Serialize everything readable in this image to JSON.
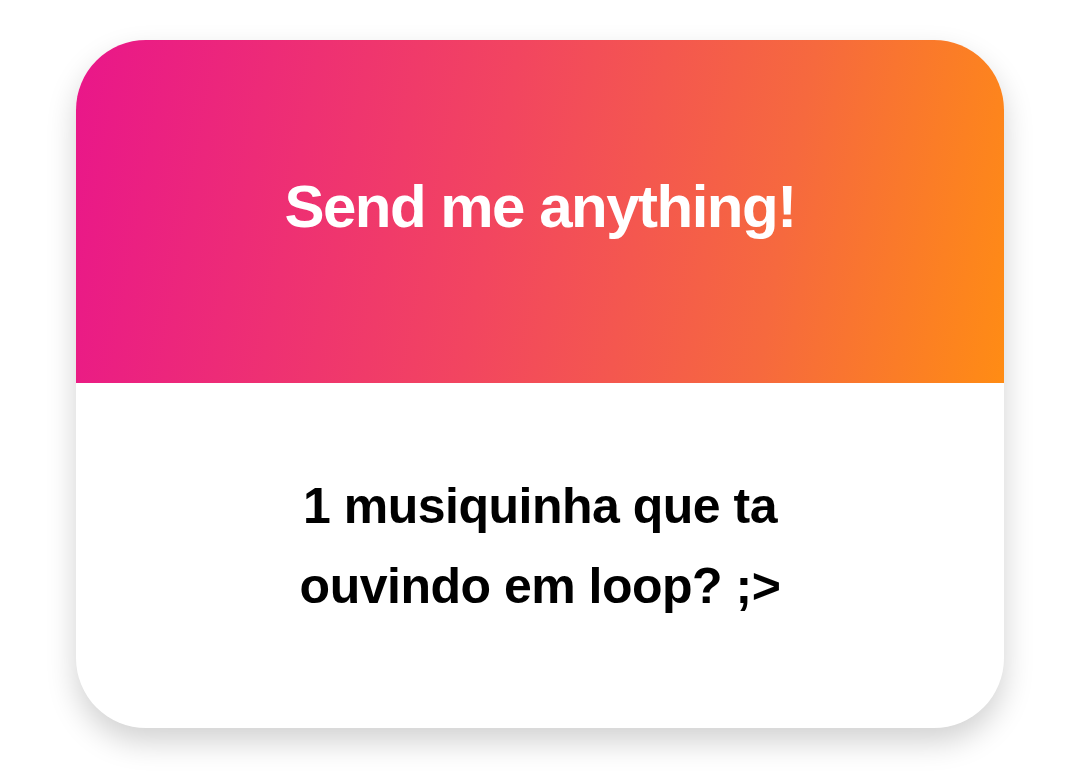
{
  "card": {
    "title": "Send me anything!",
    "question": "1 musiquinha que ta ouvindo em loop? ;>"
  }
}
